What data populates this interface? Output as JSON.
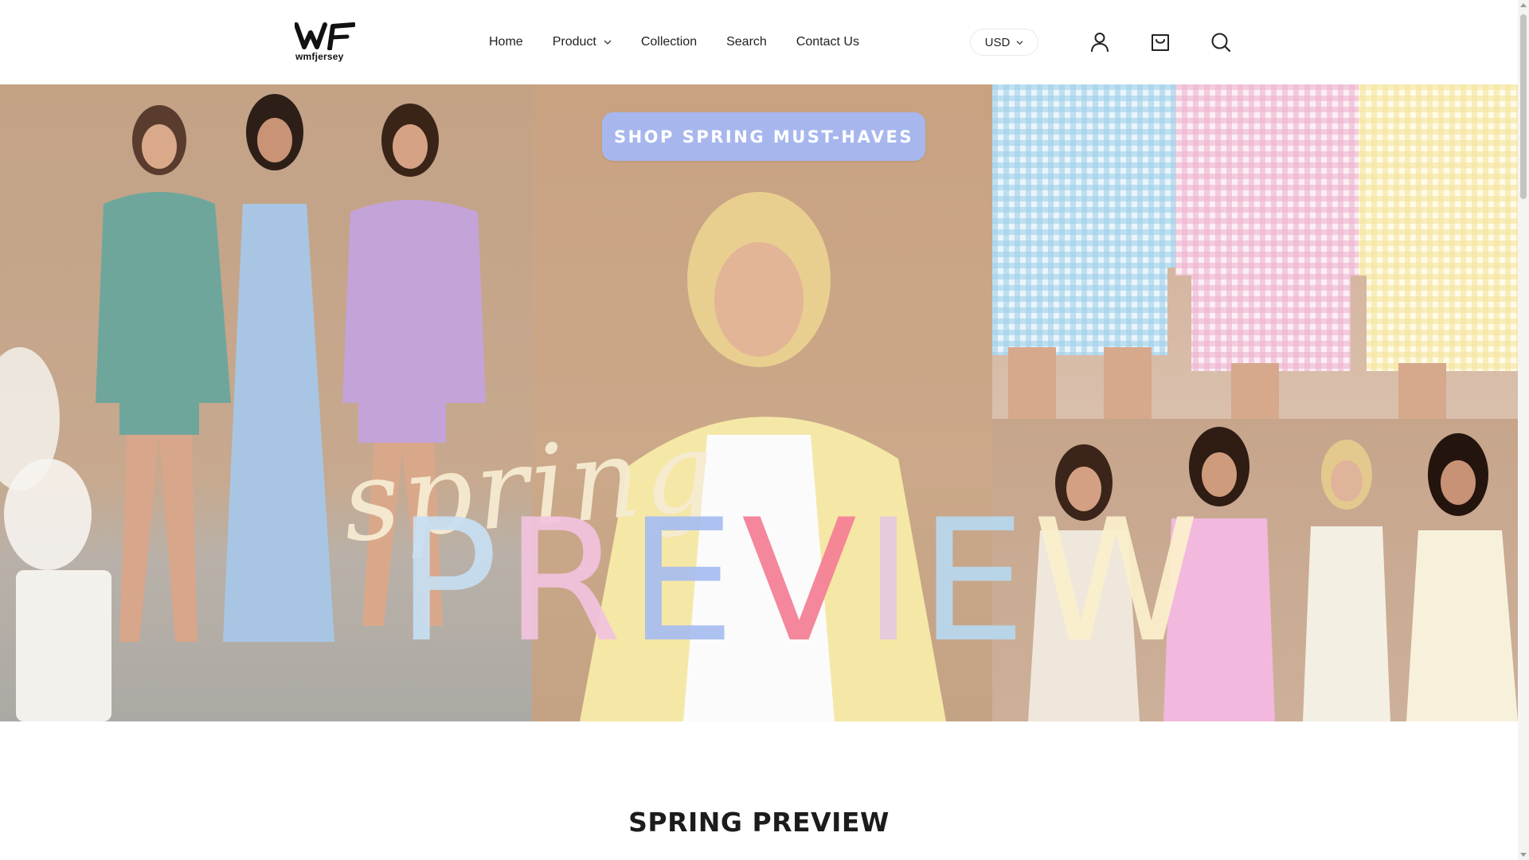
{
  "header": {
    "logo_mark": "WF",
    "logo_text": "wmfjersey",
    "nav": [
      {
        "label": "Home"
      },
      {
        "label": "Product",
        "has_dropdown": true
      },
      {
        "label": "Collection"
      },
      {
        "label": "Search"
      },
      {
        "label": "Contact Us"
      }
    ],
    "currency": "USD",
    "icons": [
      "account-icon",
      "cart-icon",
      "search-icon"
    ]
  },
  "hero": {
    "cta_label": "SHOP SPRING MUST-HAVES",
    "script_word": "spring",
    "headline_letters": [
      "P",
      "R",
      "E",
      "V",
      "I",
      "E",
      "W"
    ],
    "colors": {
      "cta_background": "#a7b7ee",
      "letter_colors": [
        "#c7dff2",
        "#f2c4df",
        "#a8bef0",
        "#f47f95",
        "#e6c8e0",
        "#b7d8ee",
        "#fbf0cc"
      ],
      "script_color": "#f6ecd2"
    }
  },
  "section": {
    "title": "SPRING PREVIEW"
  }
}
